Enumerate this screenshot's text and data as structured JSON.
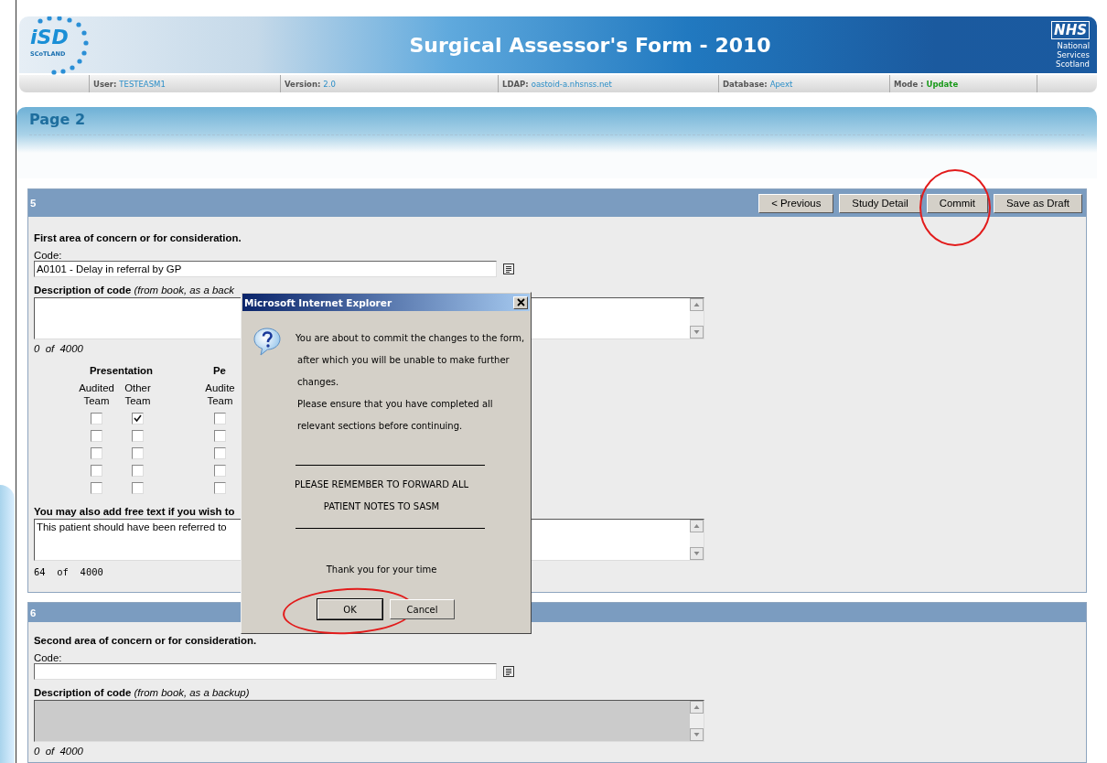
{
  "header": {
    "logo_text": "iSD",
    "logo_subtext": "SCoTLAND",
    "title": "Surgical Assessor's Form - 2010",
    "org_logo": [
      "NHS",
      "National",
      "Services",
      "Scotland"
    ],
    "info": [
      {
        "label": "User:",
        "value": "TESTEASM1",
        "kind": "plain"
      },
      {
        "label": "Version:",
        "value": "2.0",
        "kind": "plain"
      },
      {
        "label": "LDAP:",
        "value": "oastoid-a.nhsnss.net",
        "kind": "plain"
      },
      {
        "label": "Database:",
        "value": "Apext",
        "kind": "plain"
      },
      {
        "label": "Mode :",
        "value": "Update",
        "kind": "status"
      }
    ]
  },
  "page_title": "Page 2",
  "sections": [
    {
      "number": "5",
      "buttons": [
        {
          "label": "< Previous",
          "highlighted": false
        },
        {
          "label": "Study Detail",
          "highlighted": false
        },
        {
          "label": "Commit",
          "highlighted": true
        },
        {
          "label": "Save as Draft",
          "highlighted": false
        }
      ],
      "heading": "First area of concern or for consideration.",
      "code": {
        "label": "Code:",
        "value": "A0101 - Delay in referral by GP"
      },
      "description": {
        "label": "**Description of code** *(from book, as a back*",
        "disabled": false,
        "counter": "0  of  4000"
      },
      "check_groups": [
        {
          "title": "Presentation",
          "columns": [
            {
              "label": "Audited Team",
              "boxes": [
                {
                  "checked": false
                },
                {
                  "checked": false
                },
                {
                  "checked": false
                },
                {
                  "checked": false
                },
                {
                  "checked": false
                }
              ]
            },
            {
              "label": "Other Team",
              "boxes": [
                {
                  "checked": true
                },
                {
                  "checked": false
                },
                {
                  "checked": false
                },
                {
                  "checked": false
                },
                {
                  "checked": false
                }
              ]
            }
          ]
        },
        {
          "title": "Pe",
          "columns": [
            {
              "label": "Audite Team",
              "boxes": [
                {
                  "checked": false
                },
                {
                  "checked": false
                },
                {
                  "checked": false
                },
                {
                  "checked": false
                },
                {
                  "checked": false
                }
              ]
            }
          ]
        }
      ],
      "free_text": {
        "label": "You may also add free text if you wish to",
        "value": "This patient should have been referred to",
        "counter": "64  of  4000"
      }
    },
    {
      "number": "6",
      "heading": "Second area of concern or for consideration.",
      "code": {
        "label": "Code:"
      },
      "description": {
        "label": "**Description of code** *(from book, as a backup)*",
        "disabled": true,
        "counter": "0  of  4000"
      }
    }
  ],
  "dialog": {
    "title": "Microsoft Internet Explorer",
    "message": [
      "You are about to commit the changes to the form,",
      "after which you will be unable to make further",
      "changes.",
      "Please ensure that you have completed all",
      "relevant sections before continuing."
    ],
    "notice": [
      "PLEASE REMEMBER TO FORWARD ALL",
      "PATIENT NOTES TO SASM"
    ],
    "footer": "Thank you for your time",
    "buttons": [
      {
        "label": "OK",
        "default": true,
        "highlighted": true
      },
      {
        "label": "Cancel",
        "default": false,
        "highlighted": false
      }
    ]
  }
}
